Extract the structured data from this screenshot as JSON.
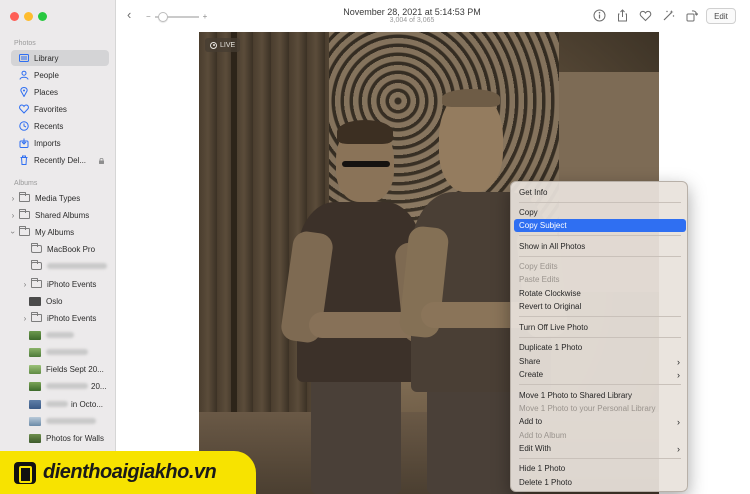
{
  "colors": {
    "accent": "#2f6ff2",
    "sidebar_bg": "#eceaeb",
    "menu_bg": "#e8e2dc",
    "watermark_bg": "#f7e300"
  },
  "toolbar": {
    "title": "November 28, 2021 at 5:14:53 PM",
    "subtitle": "3,004 of 3,065",
    "zoom_minus": "−",
    "zoom_plus": "+",
    "edit_label": "Edit",
    "icons": [
      "back-icon",
      "info-icon",
      "share-icon",
      "favorite-icon",
      "enhance-icon",
      "rotate-icon"
    ]
  },
  "sidebar": {
    "photos_header": "Photos",
    "items": [
      {
        "label": "Library",
        "icon": "library-icon",
        "active": true
      },
      {
        "label": "People",
        "icon": "people-icon"
      },
      {
        "label": "Places",
        "icon": "places-icon"
      },
      {
        "label": "Favorites",
        "icon": "heart-icon"
      },
      {
        "label": "Recents",
        "icon": "clock-icon"
      },
      {
        "label": "Imports",
        "icon": "import-icon"
      },
      {
        "label": "Recently Del...",
        "icon": "trash-icon",
        "locked": true
      }
    ],
    "albums_header": "Albums",
    "albums": [
      {
        "label": "Media Types",
        "kind": "folder",
        "expandable": true
      },
      {
        "label": "Shared Albums",
        "kind": "folder",
        "expandable": true
      },
      {
        "label": "My Albums",
        "kind": "folder",
        "expanded": true
      },
      {
        "label": "MacBook Pro",
        "kind": "album"
      },
      {
        "label": "",
        "kind": "album",
        "blurred": true
      },
      {
        "label": "iPhoto Events",
        "kind": "folder",
        "expandable": true
      },
      {
        "label": "Oslo",
        "kind": "photo"
      },
      {
        "label": "iPhoto Events",
        "kind": "folder",
        "expandable": true
      },
      {
        "label": "",
        "kind": "photo",
        "blurred": true
      },
      {
        "label": "",
        "kind": "photo",
        "blurred": true
      },
      {
        "label": "Fields Sept 20...",
        "kind": "photo"
      },
      {
        "label": "20...",
        "kind": "photo",
        "blurred_prefix": true
      },
      {
        "label": "in Octo...",
        "kind": "photo",
        "blurred_prefix": true
      },
      {
        "label": "",
        "kind": "photo",
        "blurred": true
      },
      {
        "label": "Photos for Walls",
        "kind": "photo"
      }
    ]
  },
  "photo": {
    "live_label": "LIVE"
  },
  "context_menu": {
    "items": [
      {
        "label": "Get Info"
      },
      {
        "label": "Copy"
      },
      {
        "label": "Copy Subject",
        "highlighted": true
      },
      {
        "label": "Show in All Photos"
      },
      {
        "label": "Copy Edits",
        "disabled": true
      },
      {
        "label": "Paste Edits",
        "disabled": true
      },
      {
        "label": "Rotate Clockwise"
      },
      {
        "label": "Revert to Original"
      },
      {
        "label": "Turn Off Live Photo"
      },
      {
        "label": "Duplicate 1 Photo"
      },
      {
        "label": "Share",
        "submenu": true
      },
      {
        "label": "Create",
        "submenu": true
      },
      {
        "label": "Move 1 Photo to Shared Library"
      },
      {
        "label": "Move 1 Photo to your Personal Library",
        "disabled": true
      },
      {
        "label": "Add to",
        "submenu": true
      },
      {
        "label": "Add to Album",
        "disabled": true
      },
      {
        "label": "Edit With",
        "submenu": true
      },
      {
        "label": "Hide 1 Photo"
      },
      {
        "label": "Delete 1 Photo"
      }
    ],
    "submenu_glyph": "›"
  },
  "watermark": {
    "text": "dienthoaigiakho.vn"
  }
}
